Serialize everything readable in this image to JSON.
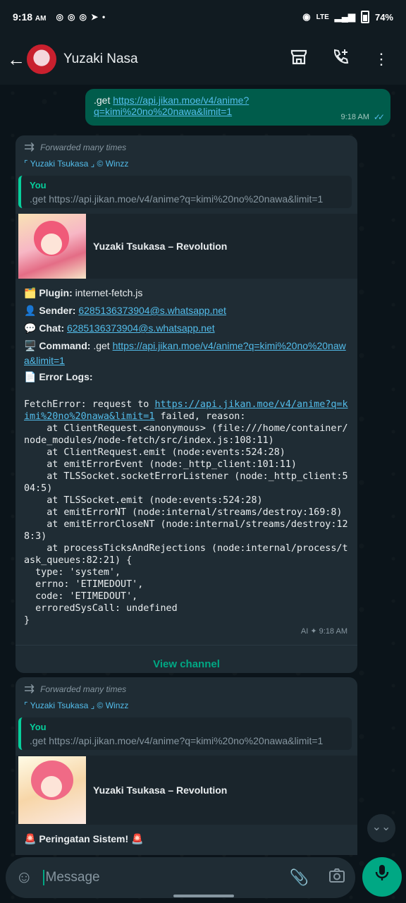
{
  "status_bar": {
    "time": "9:18",
    "time_suffix": "AM",
    "battery": "74%",
    "network": "LTE"
  },
  "header": {
    "contact_name": "Yuzaki Nasa"
  },
  "outgoing": {
    "prefix": ".get ",
    "url": "https://api.jikan.moe/v4/anime?q=kimi%20no%20nawa&limit=1",
    "time": "9:18 AM"
  },
  "message1": {
    "forwarded_label": "Forwarded many times",
    "sender_label": "⌜ Yuzaki Tsukasa ⌟ © Winzz",
    "quote_name": "You",
    "quote_text": ".get https://api.jikan.moe/v4/anime?q=kimi%20no%20nawa&limit=1",
    "preview_title": "Yuzaki Tsukasa – Revolution",
    "plugin_label": "Plugin:",
    "plugin_value": " internet-fetch.js",
    "sender_field_label": "Sender:",
    "sender_value": "6285136373904@s.whatsapp.net",
    "chat_label": "Chat:",
    "chat_value": "6285136373904@s.whatsapp.net",
    "command_label": "Command:",
    "command_prefix": " .get ",
    "command_url": "https://api.jikan.moe/v4/anime?q=kimi%20no%20nawa&limit=1",
    "errorlogs_label": "Error Logs:",
    "error_head": "FetchError: request to ",
    "error_url": "https://api.jikan.moe/v4/anime?q=kimi%20no%20nawa&limit=1",
    "error_tail": " failed, reason:\n    at ClientRequest.<anonymous> (file:///home/container/node_modules/node-fetch/src/index.js:108:11)\n    at ClientRequest.emit (node:events:524:28)\n    at emitErrorEvent (node:_http_client:101:11)\n    at TLSSocket.socketErrorListener (node:_http_client:504:5)\n    at TLSSocket.emit (node:events:524:28)\n    at emitErrorNT (node:internal/streams/destroy:169:8)\n    at emitErrorCloseNT (node:internal/streams/destroy:128:3)\n    at processTicksAndRejections (node:internal/process/task_queues:82:21) {\n  type: 'system',\n  errno: 'ETIMEDOUT',\n  code: 'ETIMEDOUT',\n  erroredSysCall: undefined\n}",
    "ai_label": "AI",
    "time": "9:18 AM",
    "view_channel": "View channel"
  },
  "message2": {
    "forwarded_label": "Forwarded many times",
    "sender_label": "⌜ Yuzaki Tsukasa ⌟ © Winzz",
    "quote_name": "You",
    "quote_text": ".get https://api.jikan.moe/v4/anime?q=kimi%20no%20nawa&limit=1",
    "preview_title": "Yuzaki Tsukasa – Revolution",
    "warning": "Peringatan Sistem!"
  },
  "composer": {
    "placeholder": "Message"
  },
  "colors": {
    "accent": "#00a884",
    "link": "#53bdeb",
    "outgoing_bubble": "#005c4b",
    "incoming_bubble": "#1f2c34"
  },
  "icons": [
    "back-arrow-icon",
    "store-icon",
    "add-call-icon",
    "more-icon",
    "forward-icon",
    "emoji-icon",
    "attach-icon",
    "camera-icon",
    "mic-icon",
    "chevron-down-icon"
  ]
}
